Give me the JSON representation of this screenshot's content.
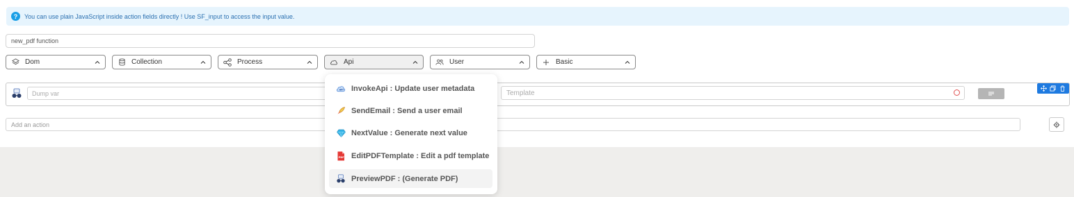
{
  "banner": {
    "text": "You can use plain JavaScript inside action fields directly ! Use SF_input to access the input value.",
    "icon": "question-circle-icon"
  },
  "function_name": "new_pdf function",
  "categories": [
    {
      "label": "Dom",
      "icon": "layers-icon"
    },
    {
      "label": "Collection",
      "icon": "database-icon"
    },
    {
      "label": "Process",
      "icon": "share-nodes-icon"
    },
    {
      "label": "Api",
      "icon": "cloud-icon"
    },
    {
      "label": "User",
      "icon": "users-icon"
    },
    {
      "label": "Basic",
      "icon": "plus-icon"
    }
  ],
  "action": {
    "dump_placeholder": "Dump var",
    "template_placeholder": "Template"
  },
  "add_action_placeholder": "Add an action",
  "dropdown": {
    "items": [
      {
        "label": "InvokeApi : Update user metadata",
        "icon": "cloud-api-icon"
      },
      {
        "label": "SendEmail : Send a user email",
        "icon": "rocket-icon"
      },
      {
        "label": "NextValue : Generate next value",
        "icon": "gem-icon"
      },
      {
        "label": "EditPDFTemplate : Edit a pdf template",
        "icon": "pdf-file-icon"
      },
      {
        "label": "PreviewPDF : (Generate PDF)",
        "icon": "pdf-glasses-icon"
      }
    ]
  },
  "colors": {
    "accent": "#1e7ae0",
    "banner_bg": "#e6f4fd",
    "banner_text": "#2a6fb0",
    "info_icon": "#1a9fe6"
  }
}
